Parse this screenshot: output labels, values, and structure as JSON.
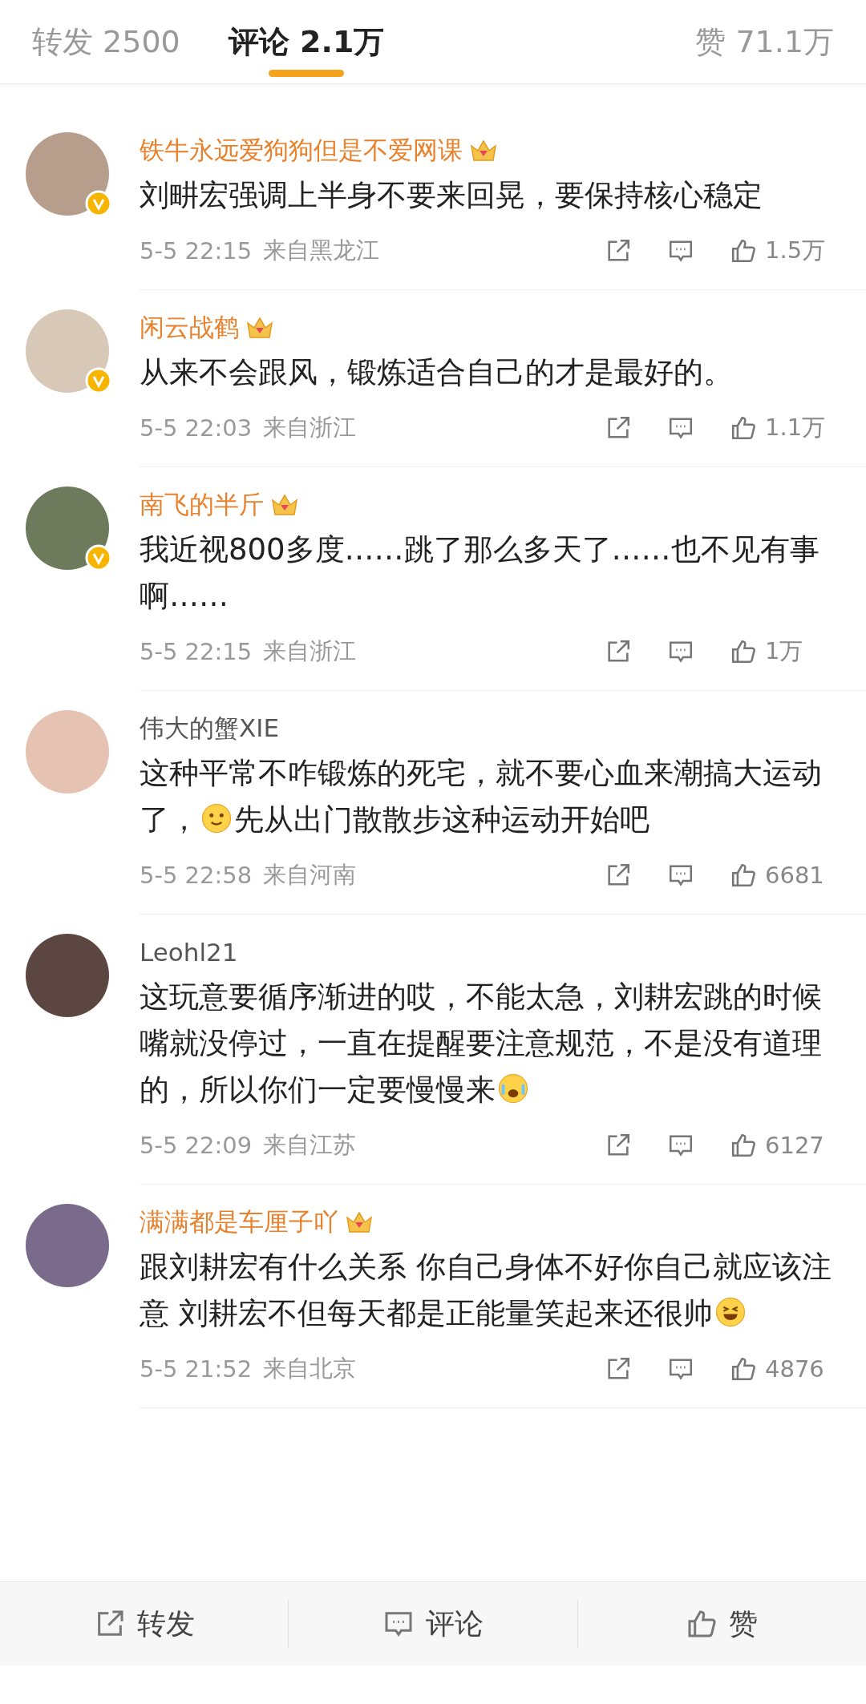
{
  "tabs": [
    {
      "label": "转发 2500",
      "selected": false
    },
    {
      "label": "评论 2.1万",
      "selected": true
    },
    {
      "label": "赞 71.1万",
      "selected": false
    }
  ],
  "comments": [
    {
      "name": "铁牛永远爱狗狗但是不爱网课",
      "vip": true,
      "verified": true,
      "text": [
        {
          "kind": "text",
          "text": "刘畊宏强调上半身不要来回晃，要保持核心稳定"
        }
      ],
      "time": "5-5 22:15",
      "location": "来自黑龙江",
      "likes": "1.5万"
    },
    {
      "name": "闲云战鹤",
      "vip": true,
      "verified": true,
      "text": [
        {
          "kind": "text",
          "text": "从来不会跟风，锻炼适合自己的才是最好的。"
        }
      ],
      "time": "5-5 22:03",
      "location": "来自浙江",
      "likes": "1.1万"
    },
    {
      "name": "南飞的半斤",
      "vip": true,
      "verified": true,
      "text": [
        {
          "kind": "text",
          "text": "我近视800多度……跳了那么多天了……也不见有事啊……"
        }
      ],
      "time": "5-5 22:15",
      "location": "来自浙江",
      "likes": "1万"
    },
    {
      "name": "伟大的蟹XIE",
      "vip": false,
      "verified": false,
      "text": [
        {
          "kind": "text",
          "text": "这种平常不咋锻炼的死宅，就不要心血来潮搞大运动了，"
        },
        {
          "kind": "smile"
        },
        {
          "kind": "text",
          "text": "先从出门散散步这种运动开始吧"
        }
      ],
      "time": "5-5 22:58",
      "location": "来自河南",
      "likes": "6681"
    },
    {
      "name": "Leohl21",
      "vip": false,
      "verified": false,
      "text": [
        {
          "kind": "text",
          "text": "这玩意要循序渐进的哎，不能太急，刘耕宏跳的时候嘴就没停过，一直在提醒要注意规范，不是没有道理的，所以你们一定要慢慢来"
        },
        {
          "kind": "cry"
        }
      ],
      "time": "5-5 22:09",
      "location": "来自江苏",
      "likes": "6127"
    },
    {
      "name": "满满都是车厘子吖",
      "vip": true,
      "verified": false,
      "text": [
        {
          "kind": "text",
          "text": "跟刘耕宏有什么关系 你自己身体不好你自己就应该注意 刘耕宏不但每天都是正能量笑起来还很帅"
        },
        {
          "kind": "grin"
        }
      ],
      "time": "5-5 21:52",
      "location": "来自北京",
      "likes": "4876"
    }
  ],
  "bottom_bar": [
    {
      "kind": "share",
      "label": "转发"
    },
    {
      "kind": "comment",
      "label": "评论"
    },
    {
      "kind": "like",
      "label": "赞"
    }
  ]
}
